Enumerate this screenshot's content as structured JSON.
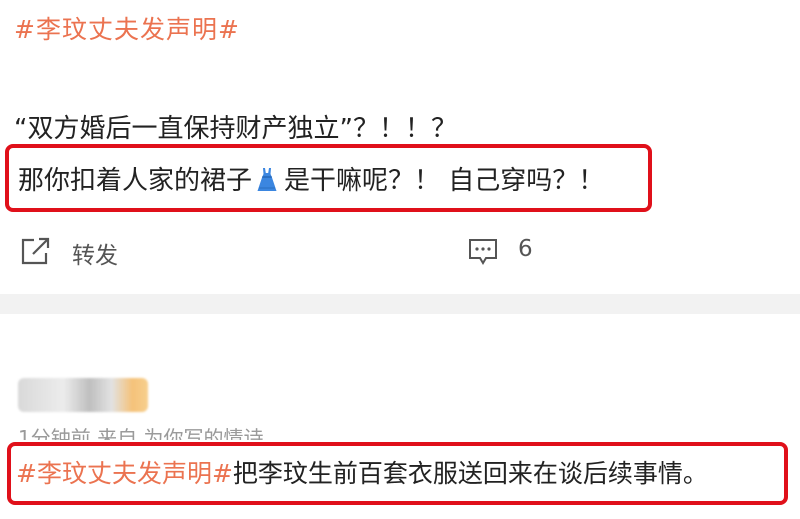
{
  "post1": {
    "hashtag": "#李玟丈夫发声明#",
    "line1": "“双方婚后一直保持财产独立”？！！？",
    "line2_before": "那你扣着人家的裙子",
    "line2_after": "是干嘛呢？！ 自己穿吗？！",
    "emoji_icon": "dress-emoji",
    "actions": {
      "share_label": "转发",
      "comment_count": "6"
    }
  },
  "post2": {
    "meta": "1分钟前  来自 为你写的情诗",
    "hashtag": "#李玟丈夫发声明#",
    "text": "把李玟生前百套衣服送回来在谈后续事情。"
  },
  "colors": {
    "hashtag": "#eb7350",
    "highlight_box": "#e0101a",
    "separator": "#f2f2f2"
  }
}
